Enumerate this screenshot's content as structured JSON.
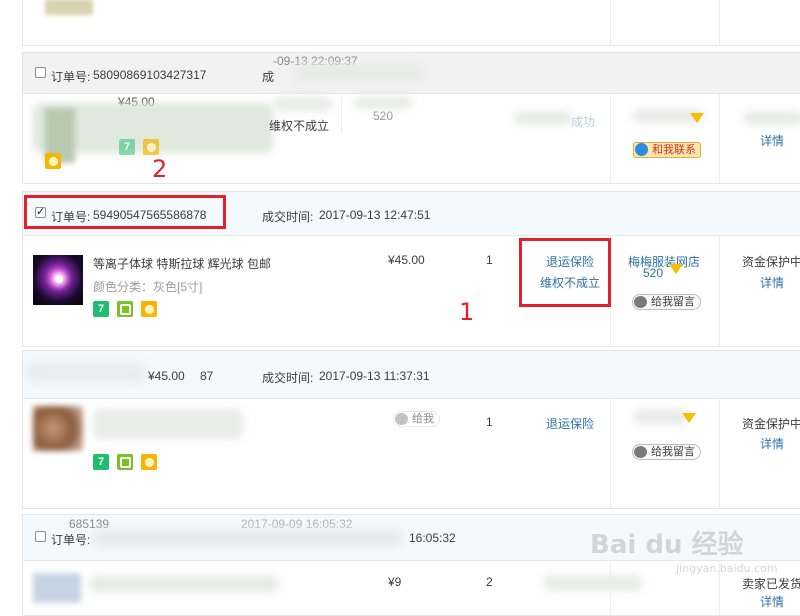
{
  "labels": {
    "order_no": "订单号:",
    "deal_time": "成交时间:"
  },
  "orders": [
    {
      "order_number": "58090869103427317",
      "deal_time_partial": "-09-13 22:09:37",
      "deal_prefix": "成",
      "price": "¥45.00",
      "service_text": "维权不成立",
      "shop_fragment": "520",
      "status_fragment": "成功",
      "detail_link": "详情",
      "contact_label": "和我联系"
    },
    {
      "order_number": "59490547565586878",
      "checked": true,
      "deal_time": "2017-09-13 12:47:51",
      "product_title": "等离子体球 特斯拉球 辉光球 包邮",
      "product_variant": "颜色分类：灰色[5寸]",
      "price": "¥45.00",
      "quantity": "1",
      "insurance_link": "退运保险",
      "rights_status": "维权不成立",
      "shop_name": "梅梅服装网店",
      "shop_sub": "520",
      "leave_message": "给我留言",
      "status": "资金保护中",
      "detail_link": "详情"
    },
    {
      "order_number_fragment": "87",
      "deal_time": "2017-09-13 11:37:31",
      "price": "¥45.00",
      "quantity": "1",
      "insurance_link": "退运保险",
      "leave_message_faded": "给我",
      "leave_message": "给我留言",
      "status": "资金保护中",
      "detail_link": "详情"
    },
    {
      "order_number_fragment": "685139",
      "deal_time_partial": "16:05:32",
      "deal_time_faded_top": "2017-09-09 16:05:32",
      "price_partial": "¥9",
      "quantity": "2",
      "status": "卖家已发货",
      "detail_link": "详情"
    }
  ],
  "annotations": {
    "number_1": "1",
    "number_2": "2",
    "color": "#e5202a"
  },
  "watermark": {
    "logo": "Bai du 经验",
    "url": "jingyan.baidu.com"
  },
  "colors": {
    "header_blue": "#f3f9fd",
    "header_gray": "#f2f2f2",
    "link": "#3071a9",
    "border": "#e6e6e6"
  }
}
